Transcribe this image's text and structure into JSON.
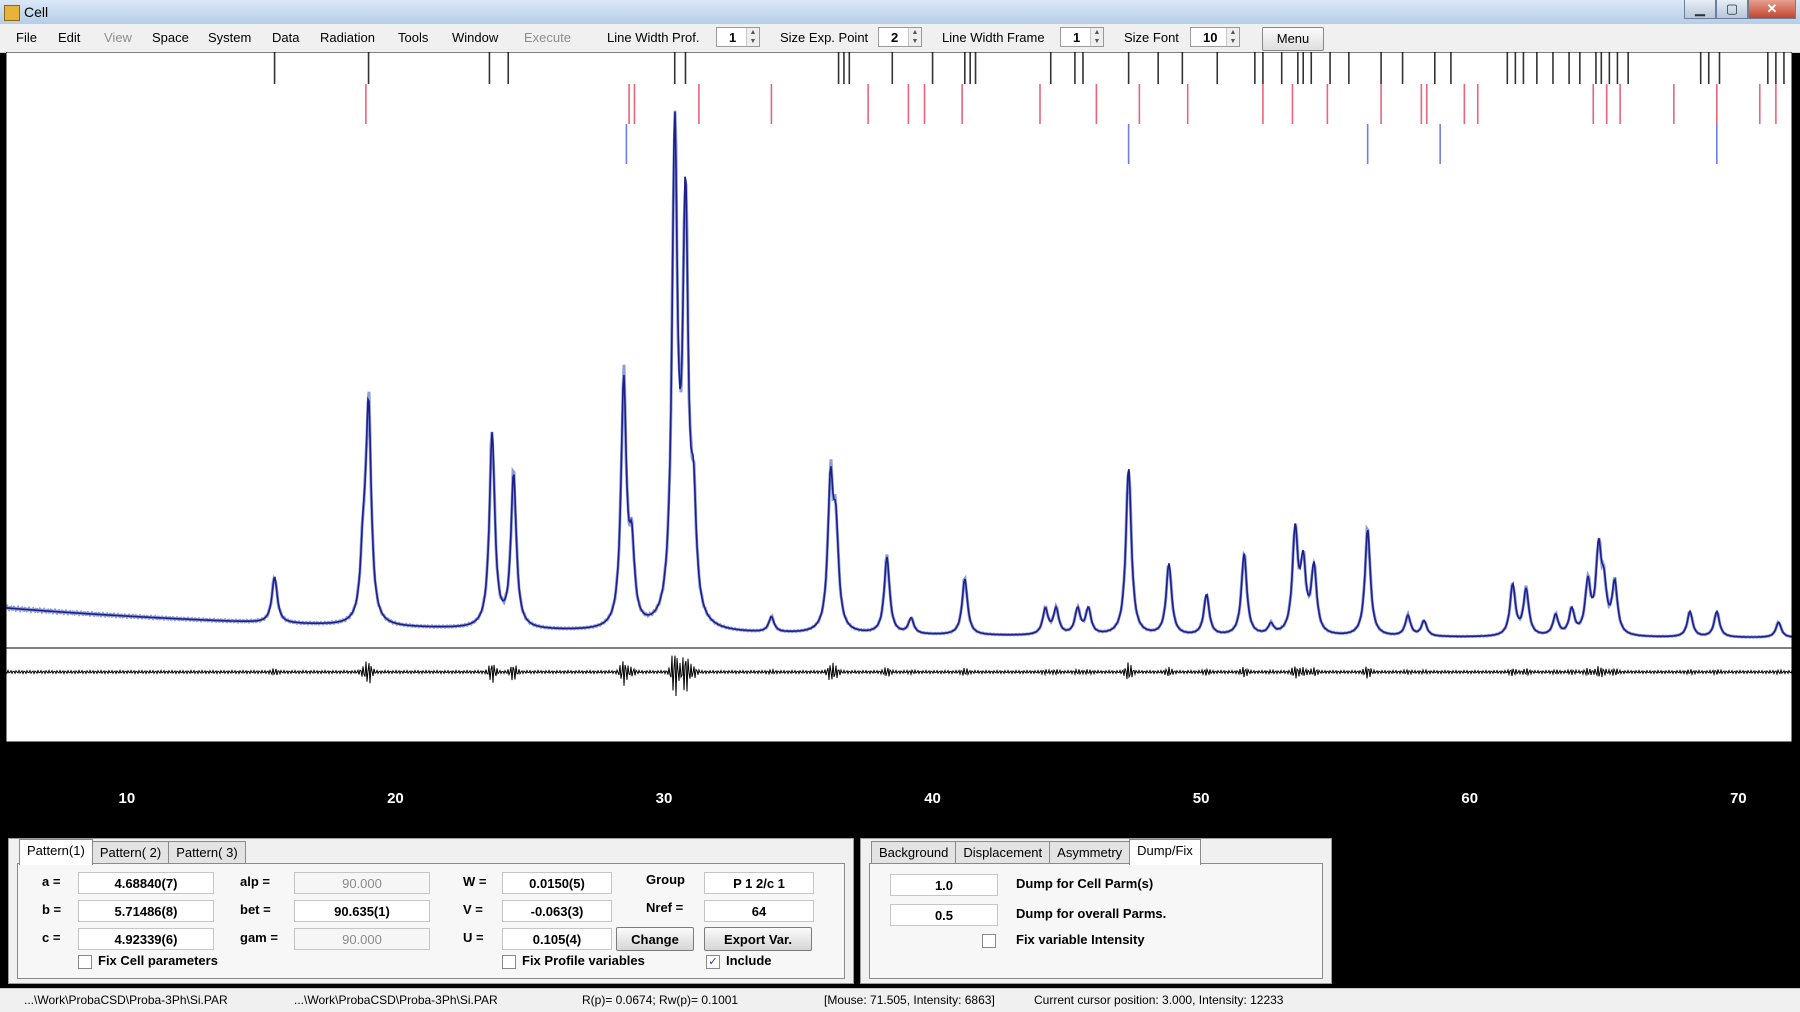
{
  "window": {
    "title": "Cell",
    "minimize": "▁",
    "maximize": "▢",
    "close": "✕"
  },
  "menu": {
    "items": [
      "File",
      "Edit",
      "View",
      "Space",
      "System",
      "Data",
      "Radiation",
      "Tools",
      "Window",
      "Execute"
    ],
    "line_width_prof_label": "Line Width Prof.",
    "line_width_prof": "1",
    "size_exp_point_label": "Size Exp. Point",
    "size_exp_point": "2",
    "line_width_frame_label": "Line Width Frame",
    "line_width_frame": "1",
    "size_font_label": "Size Font",
    "size_font": "10",
    "menu_button": "Menu"
  },
  "colors": {
    "observed": "#6a7fc8",
    "calculated": "#1e1e8c",
    "difference": "#000000",
    "phase1_ticks": "#333333",
    "phase2_ticks": "#e8657a",
    "phase3_ticks": "#6f7ee8"
  },
  "chart_data": {
    "type": "line",
    "x_ticks": [
      "10",
      "20",
      "30",
      "40",
      "50",
      "60",
      "70"
    ],
    "xlim": [
      5.5,
      72
    ],
    "phase_ticks": [
      {
        "name": "phase1",
        "x": [
          15.5,
          19.0,
          23.5,
          24.2,
          30.4,
          30.8,
          36.5,
          36.7,
          36.9,
          38.5,
          40.0,
          41.2,
          41.4,
          41.6,
          44.4,
          45.3,
          45.6,
          47.3,
          48.4,
          49.3,
          50.6,
          52.0,
          52.3,
          53.0,
          53.6,
          53.8,
          54.1,
          54.8,
          55.5,
          56.7,
          57.5,
          58.7,
          59.3,
          61.4,
          61.7,
          62.0,
          62.5,
          63.1,
          63.7,
          64.1,
          64.7,
          64.9,
          65.2,
          65.5,
          65.9,
          68.6,
          68.9,
          69.3,
          71.1,
          71.4,
          71.7
        ]
      },
      {
        "name": "phase2",
        "x": [
          18.9,
          28.7,
          28.9,
          31.3,
          34.0,
          37.6,
          39.1,
          39.7,
          41.1,
          44.0,
          46.1,
          47.7,
          49.5,
          52.3,
          53.4,
          54.7,
          56.7,
          58.2,
          58.4,
          59.8,
          60.3,
          64.6,
          65.1,
          65.6,
          67.6,
          69.2,
          70.8,
          71.4
        ]
      },
      {
        "name": "phase3",
        "x": [
          28.6,
          47.3,
          56.2,
          58.9,
          69.2
        ]
      }
    ],
    "peaks": [
      {
        "x": 15.5,
        "h": 0.09
      },
      {
        "x": 18.8,
        "h": 0.12
      },
      {
        "x": 19.0,
        "h": 0.42
      },
      {
        "x": 23.6,
        "h": 0.38
      },
      {
        "x": 24.4,
        "h": 0.3
      },
      {
        "x": 28.5,
        "h": 0.48
      },
      {
        "x": 28.8,
        "h": 0.14
      },
      {
        "x": 30.4,
        "h": 0.95
      },
      {
        "x": 30.8,
        "h": 0.8
      },
      {
        "x": 31.1,
        "h": 0.2
      },
      {
        "x": 34.0,
        "h": 0.03
      },
      {
        "x": 36.2,
        "h": 0.28
      },
      {
        "x": 36.4,
        "h": 0.18
      },
      {
        "x": 38.3,
        "h": 0.15
      },
      {
        "x": 39.2,
        "h": 0.03
      },
      {
        "x": 41.2,
        "h": 0.11
      },
      {
        "x": 44.2,
        "h": 0.05
      },
      {
        "x": 44.6,
        "h": 0.05
      },
      {
        "x": 45.4,
        "h": 0.05
      },
      {
        "x": 45.8,
        "h": 0.05
      },
      {
        "x": 47.3,
        "h": 0.33
      },
      {
        "x": 48.8,
        "h": 0.14
      },
      {
        "x": 50.2,
        "h": 0.08
      },
      {
        "x": 51.6,
        "h": 0.16
      },
      {
        "x": 52.6,
        "h": 0.02
      },
      {
        "x": 53.5,
        "h": 0.2
      },
      {
        "x": 53.8,
        "h": 0.13
      },
      {
        "x": 54.2,
        "h": 0.13
      },
      {
        "x": 56.2,
        "h": 0.21
      },
      {
        "x": 57.7,
        "h": 0.04
      },
      {
        "x": 58.3,
        "h": 0.03
      },
      {
        "x": 61.6,
        "h": 0.1
      },
      {
        "x": 62.1,
        "h": 0.09
      },
      {
        "x": 63.2,
        "h": 0.04
      },
      {
        "x": 63.8,
        "h": 0.05
      },
      {
        "x": 64.4,
        "h": 0.1
      },
      {
        "x": 64.8,
        "h": 0.16
      },
      {
        "x": 65.0,
        "h": 0.08
      },
      {
        "x": 65.4,
        "h": 0.1
      },
      {
        "x": 68.2,
        "h": 0.05
      },
      {
        "x": 69.2,
        "h": 0.05
      },
      {
        "x": 71.5,
        "h": 0.03
      }
    ]
  },
  "tabs_left": [
    "Pattern(1)",
    "Pattern( 2)",
    "Pattern( 3)"
  ],
  "cell": {
    "a_label": "a =",
    "a": "4.68840(7)",
    "b_label": "b =",
    "b": "5.71486(8)",
    "c_label": "c =",
    "c": "4.92339(6)",
    "alp_label": "alp =",
    "alp": "90.000",
    "bet_label": "bet =",
    "bet": "90.635(1)",
    "gam_label": "gam =",
    "gam": "90.000",
    "fix_cell": "Fix Cell parameters"
  },
  "profile": {
    "w_label": "W =",
    "w": "0.0150(5)",
    "v_label": "V =",
    "v": "-0.063(3)",
    "u_label": "U =",
    "u": "0.105(4)",
    "fix_profile": "Fix Profile variables"
  },
  "group": {
    "group_label": "Group",
    "group": "P 1 2/c 1",
    "nref_label": "Nref =",
    "nref": "64",
    "change": "Change",
    "export": "Export Var.",
    "include": "Include",
    "include_checked": "✓"
  },
  "tabs_right": [
    "Background",
    "Displacement",
    "Asymmetry",
    "Dump/Fix"
  ],
  "dump": {
    "cell_value": "1.0",
    "cell_label": "Dump for Cell Parm(s)",
    "overall_value": "0.5",
    "overall_label": "Dump for overall Parms.",
    "fix_intensity": "Fix variable Intensity"
  },
  "status": {
    "path1": "...\\Work\\ProbaCSD\\Proba-3Ph\\Si.PAR",
    "path2": "...\\Work\\ProbaCSD\\Proba-3Ph\\Si.PAR",
    "r_factors": "R(p)= 0.0674;  Rw(p)= 0.1001",
    "mouse": "[Mouse: 71.505, Intensity: 6863]",
    "cursor": "Current cursor position: 3.000, Intensity: 12233"
  }
}
